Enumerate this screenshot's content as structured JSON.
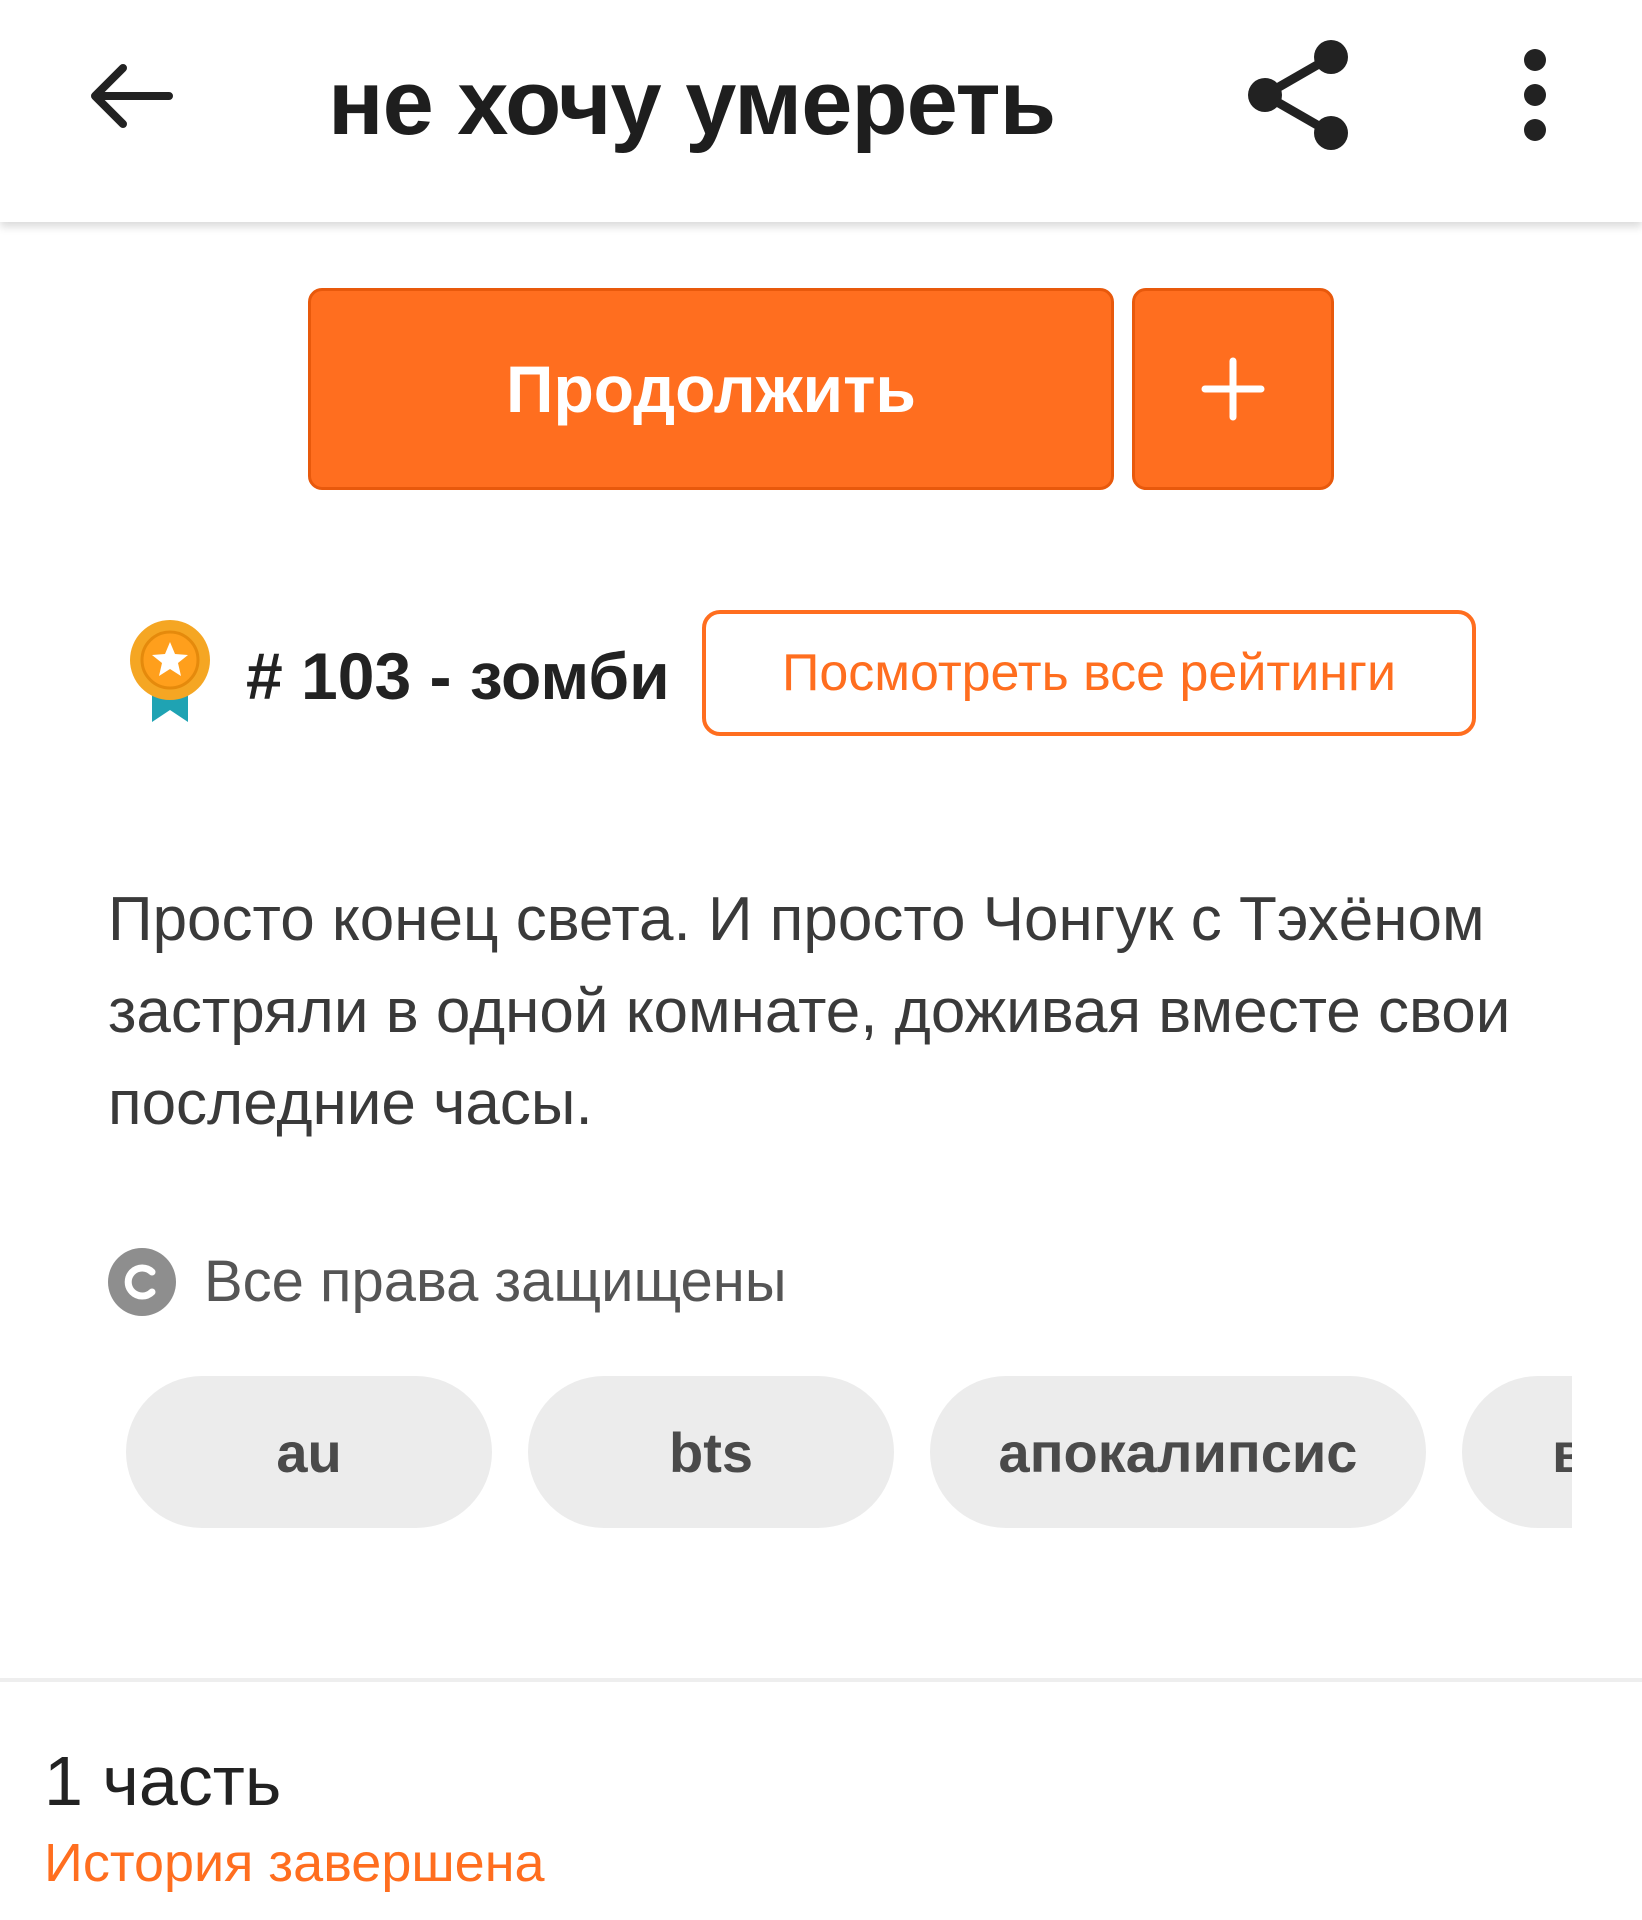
{
  "appbar": {
    "title": "не хочу умереть",
    "back_icon": "arrow-left-icon",
    "share_icon": "share-icon",
    "more_icon": "more-vertical-icon"
  },
  "actions": {
    "continue_label": "Продолжить",
    "add_label": "+"
  },
  "ranking": {
    "icon": "medal-icon",
    "text": "# 103 - зомби",
    "view_all_label": "Посмотреть все рейтинги"
  },
  "description": "Просто конец света. И просто Чонгук с Тэхёном застряли в одной комнате, доживая вместе свои последние часы.",
  "copyright": {
    "icon": "copyright-icon",
    "text": "Все права защищены"
  },
  "tags": [
    {
      "label": "au"
    },
    {
      "label": "bts"
    },
    {
      "label": "апокалипсис"
    },
    {
      "label": "в"
    }
  ],
  "footer": {
    "parts": "1 часть",
    "status": "История завершена"
  },
  "colors": {
    "accent": "#ff6e1f",
    "tag_bg": "#ececec",
    "medal_gold": "#f5a623",
    "medal_ribbon": "#1fa3b3"
  }
}
